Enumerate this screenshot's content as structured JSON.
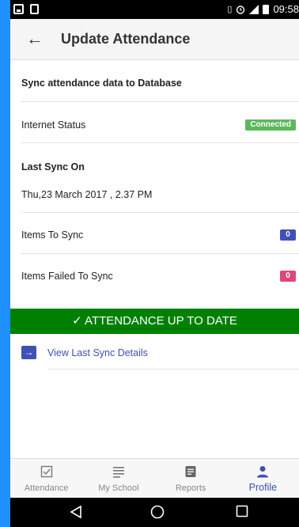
{
  "status_bar": {
    "time": "09:58",
    "icons": [
      "image-icon",
      "sd-card-icon",
      "vibrate-icon",
      "alarm-icon",
      "signal-icon",
      "battery-icon"
    ]
  },
  "appbar": {
    "title": "Update Attendance"
  },
  "content": {
    "sync_heading": "Sync attendance data to Database",
    "internet_status_label": "Internet Status",
    "internet_status_value": "Connected",
    "last_sync_label": "Last Sync On",
    "last_sync_value": "Thu,23 March 2017 , 2.37 PM",
    "items_to_sync_label": "Items To Sync",
    "items_to_sync_count": "0",
    "items_failed_label": "Items Failed To Sync",
    "items_failed_count": "0",
    "banner_text": "✓ ATTENDANCE UP TO DATE",
    "view_details_label": "View Last Sync Details"
  },
  "bottom_nav": {
    "items": [
      {
        "label": "Attendance",
        "icon": "checkbox-icon",
        "active": false
      },
      {
        "label": "My School",
        "icon": "list-icon",
        "active": false
      },
      {
        "label": "Reports",
        "icon": "document-icon",
        "active": false
      },
      {
        "label": "Profile",
        "icon": "person-icon",
        "active": true
      }
    ]
  },
  "colors": {
    "page_background": "#1e90ff",
    "connected_badge": "#5cb85c",
    "items_to_sync_badge": "#3f51b5",
    "items_failed_badge": "#e0457b",
    "banner": "#008000",
    "accent": "#3f51b5"
  }
}
